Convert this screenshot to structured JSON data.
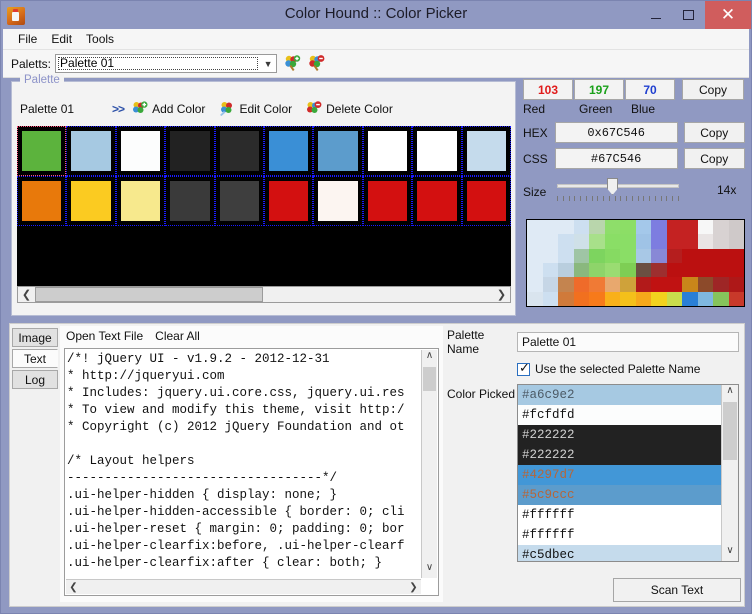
{
  "window": {
    "title": "Color Hound :: Color Picker",
    "icon": "app-dog-icon",
    "minimize": "–",
    "maximize": "□",
    "close": "✕"
  },
  "menu": {
    "items": [
      "File",
      "Edit",
      "Tools"
    ]
  },
  "palette_selector": {
    "label": "Paletts:",
    "value": "Palette 01",
    "arrow": "⌄",
    "add_palette_icon": "add-palette-icon",
    "delete_palette_icon": "delete-palette-icon"
  },
  "palette_group": {
    "legend": "Palette",
    "name": "Palette 01",
    "chevrons": ">>",
    "tools": [
      {
        "label": "Add Color",
        "icon": "add-color-icon"
      },
      {
        "label": "Edit Color",
        "icon": "edit-color-icon"
      },
      {
        "label": "Delete Color",
        "icon": "delete-color-icon"
      }
    ],
    "swatches_row1": [
      "#5cb33d",
      "#a6c9e2",
      "#fcfdfd",
      "#222222",
      "#2b2b2b",
      "#3a8fd6",
      "#5c9ccc",
      "#ffffff",
      "#ffffff",
      "#c5dbec"
    ],
    "swatches_row2": [
      "#e8790b",
      "#fbcb21",
      "#f7e98d",
      "#3a3a3a",
      "#3e3e3e",
      "#d31010",
      "#fcf5f1",
      "#d31010",
      "#d31010",
      "#d31010"
    ],
    "selected_index": 0,
    "scroll_left_arrow": "❮",
    "scroll_right_arrow": "❯"
  },
  "color_readout": {
    "red": "103",
    "green": "197",
    "blue": "70",
    "label_red": "Red",
    "label_green": "Green",
    "label_blue": "Blue",
    "copy_rgb": "Copy",
    "hex_key": "HEX",
    "hex_value": "0x67C546",
    "copy_hex": "Copy",
    "css_key": "CSS",
    "css_value": "#67C546",
    "copy_css": "Copy",
    "size_label": "Size",
    "zoom_level": "14x",
    "accent_red": "#e01b1b",
    "accent_green": "#1aa11a",
    "accent_blue": "#1f3fd0",
    "picked_color": "#67C546"
  },
  "preview_pixels": [
    "#dfeaf5",
    "#dfeaf5",
    "#dfeaf5",
    "#cddff0",
    "#b9d6ac",
    "#8ede6a",
    "#8cde66",
    "#a4c8ea",
    "#7d7de0",
    "#c42222",
    "#c42222",
    "#f7f7f7",
    "#d8d2d2",
    "#cfc9c9",
    "#dfeaf5",
    "#dfeaf5",
    "#cddff0",
    "#cfe0e8",
    "#a8e08a",
    "#8ade66",
    "#8ade66",
    "#9fc3e6",
    "#7d7de0",
    "#c42222",
    "#c42222",
    "#e9e4e4",
    "#d8d2d2",
    "#cfc9c9",
    "#dfeaf5",
    "#dfeaf5",
    "#cddff0",
    "#9fc5a5",
    "#7dd45f",
    "#86da62",
    "#8ade66",
    "#a8c8e6",
    "#8888d6",
    "#b51e1e",
    "#bb1010",
    "#bb1010",
    "#bb1010",
    "#bb1010",
    "#dfeaf5",
    "#cddff0",
    "#b9cede",
    "#8ab87e",
    "#8ed46a",
    "#9adc72",
    "#7ece54",
    "#6b4f42",
    "#9d2f2f",
    "#bb1010",
    "#bb1010",
    "#bb1010",
    "#bb1010",
    "#bb1010",
    "#dfeaf5",
    "#c6d6e6",
    "#c4844f",
    "#ef6b2a",
    "#f07a35",
    "#e8a86e",
    "#cfa23a",
    "#b21a1a",
    "#c01212",
    "#c01212",
    "#c9861a",
    "#8c4a2a",
    "#9e2626",
    "#ae1818",
    "#d9e4ee",
    "#cddff0",
    "#d07a3a",
    "#f1701f",
    "#f77a1a",
    "#f9b01a",
    "#f4c01a",
    "#f6a81a",
    "#f2d21e",
    "#c9dd4c",
    "#2a7fd6",
    "#7fb8e0",
    "#86c45c",
    "#c8392a"
  ],
  "bottom": {
    "tabs": [
      {
        "label": "Image",
        "active": false
      },
      {
        "label": "Text",
        "active": true
      },
      {
        "label": "Log",
        "active": false
      }
    ],
    "text_actions": [
      "Open Text File",
      "Clear All"
    ],
    "code": "/*! jQuery UI - v1.9.2 - 2012-12-31\n* http://jqueryui.com\n* Includes: jquery.ui.core.css, jquery.ui.res\n* To view and modify this theme, visit http:/\n* Copyright (c) 2012 jQuery Foundation and ot\n\n/* Layout helpers\n----------------------------------*/\n.ui-helper-hidden { display: none; }\n.ui-helper-hidden-accessible { border: 0; cli\n.ui-helper-reset { margin: 0; padding: 0; bor\n.ui-helper-clearfix:before, .ui-helper-clearf\n.ui-helper-clearfix:after { clear: both; }",
    "scroll_up": "∧",
    "scroll_down": "∨",
    "scroll_left": "❮",
    "scroll_right": "❯"
  },
  "picker_panel": {
    "palette_name_label": "Palette Name",
    "palette_name_value": "Palette 01",
    "use_palette_checkbox_label": "Use the selected Palette Name",
    "use_palette_checked": true,
    "color_picked_label": "Color Picked",
    "colors": [
      {
        "hex": "#a6c9e2",
        "bg": "#a6c9e2",
        "fg": "#4c5a66",
        "selected": true
      },
      {
        "hex": "#fcfdfd",
        "bg": "#fcfdfd",
        "fg": "#111111",
        "selected": false
      },
      {
        "hex": "#222222",
        "bg": "#222222",
        "fg": "#cfcfcf",
        "selected": false
      },
      {
        "hex": "#222222",
        "bg": "#222222",
        "fg": "#cfcfcf",
        "selected": false
      },
      {
        "hex": "#4297d7",
        "bg": "#4297d7",
        "fg": "#b5663a",
        "selected": false
      },
      {
        "hex": "#5c9ccc",
        "bg": "#5c9ccc",
        "fg": "#b5663a",
        "selected": false
      },
      {
        "hex": "#ffffff",
        "bg": "#ffffff",
        "fg": "#111111",
        "selected": false
      },
      {
        "hex": "#ffffff",
        "bg": "#ffffff",
        "fg": "#111111",
        "selected": false
      },
      {
        "hex": "#c5dbec",
        "bg": "#c5dbec",
        "fg": "#111111",
        "selected": false
      }
    ],
    "scan_button": "Scan Text"
  }
}
